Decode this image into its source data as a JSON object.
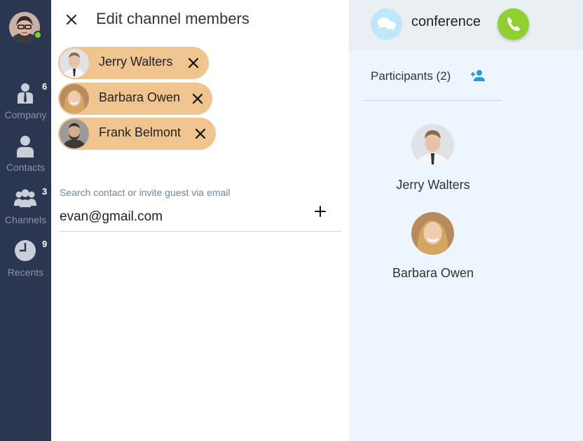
{
  "sidebar": {
    "items": [
      {
        "label": "Company",
        "badge": "6",
        "icon": "company-icon"
      },
      {
        "label": "Contacts",
        "badge": "",
        "icon": "contacts-icon"
      },
      {
        "label": "Channels",
        "badge": "3",
        "icon": "channels-icon"
      },
      {
        "label": "Recents",
        "badge": "9",
        "icon": "recents-icon"
      }
    ],
    "presence_color": "#7ed321"
  },
  "panel": {
    "title": "Edit channel members",
    "chips": [
      {
        "name": "Jerry Walters"
      },
      {
        "name": "Barbara Owen"
      },
      {
        "name": "Frank Belmont"
      }
    ],
    "search": {
      "label": "Search contact or invite guest via email",
      "value": "evan@gmail.com"
    }
  },
  "right": {
    "channel_title": "conference",
    "participants_label": "Participants (2)",
    "participants": [
      {
        "name": "Jerry Walters"
      },
      {
        "name": "Barbara Owen"
      }
    ]
  },
  "colors": {
    "sidebar_bg": "#2b3750",
    "chip_bg": "#f0c48f",
    "call_green": "#8fcf2f",
    "accent_blue": "#1a9fd8"
  }
}
